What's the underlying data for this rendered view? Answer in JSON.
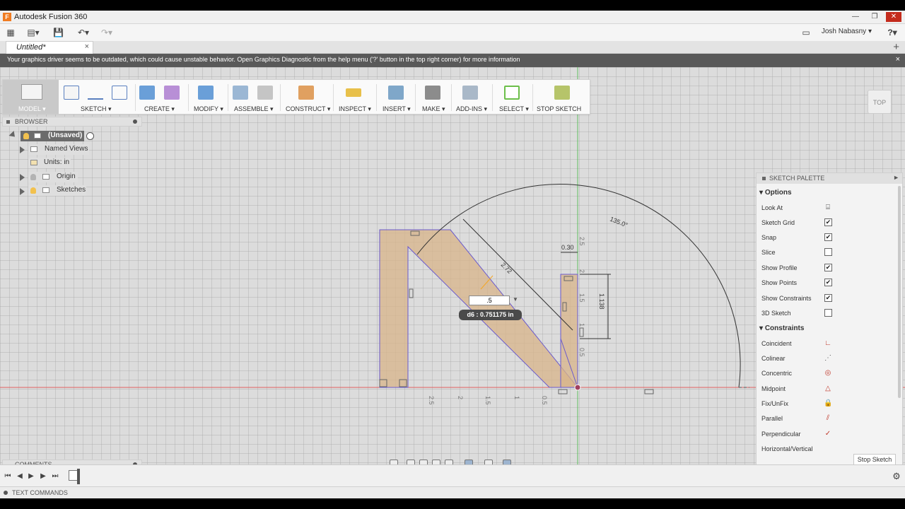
{
  "window": {
    "title": "Autodesk Fusion 360",
    "app_icon": "F"
  },
  "quick_access": {
    "user_name": "Josh Nabasny",
    "help_label": "?"
  },
  "document": {
    "tab_title": "Untitled*",
    "close": "×",
    "new_tab": "+"
  },
  "warning": {
    "message": "Your graphics driver seems to be outdated, which could cause unstable behavior. Open Graphics Diagnostic from the help menu ('?' button in the top right corner) for more information",
    "close": "×"
  },
  "toolbar": {
    "model_label": "MODEL ▾",
    "groups": [
      "SKETCH ▾",
      "CREATE ▾",
      "MODIFY ▾",
      "ASSEMBLE ▾",
      "CONSTRUCT ▾",
      "INSPECT ▾",
      "INSERT ▾",
      "MAKE ▾",
      "ADD-INS ▾",
      "SELECT ▾",
      "STOP SKETCH"
    ]
  },
  "viewcube": {
    "face": "TOP"
  },
  "browser": {
    "title": "BROWSER",
    "root": "(Unsaved)",
    "items": [
      "Named Views",
      "Units: in",
      "Origin",
      "Sketches"
    ]
  },
  "comments": {
    "title": "COMMENTS"
  },
  "sketch_palette": {
    "title": "SKETCH PALETTE",
    "options_header": "Options",
    "options": [
      {
        "label": "Look At",
        "type": "icon"
      },
      {
        "label": "Sketch Grid",
        "checked": true
      },
      {
        "label": "Snap",
        "checked": true
      },
      {
        "label": "Slice",
        "checked": false
      },
      {
        "label": "Show Profile",
        "checked": true
      },
      {
        "label": "Show Points",
        "checked": true
      },
      {
        "label": "Show Constraints",
        "checked": true
      },
      {
        "label": "3D Sketch",
        "checked": false
      }
    ],
    "constraints_header": "Constraints",
    "constraints": [
      "Coincident",
      "Colinear",
      "Concentric",
      "Midpoint",
      "Fix/UnFix",
      "Parallel",
      "Perpendicular",
      "Horizontal/Vertical"
    ],
    "stop_button": "Stop Sketch"
  },
  "sketch": {
    "dim_input_value": ".5",
    "dim_tooltip": "d6 : 0.751175 in",
    "labels": {
      "angle": "135.0°",
      "diag": "2.72",
      "width": "0.30",
      "height": "1.138",
      "axis_x": [
        "2.5",
        "2",
        "1.5",
        "1",
        "0.5"
      ],
      "axis_y": [
        "2.5",
        "2",
        "1.5",
        "1",
        "0.5"
      ]
    }
  },
  "text_commands": {
    "title": "TEXT COMMANDS"
  }
}
